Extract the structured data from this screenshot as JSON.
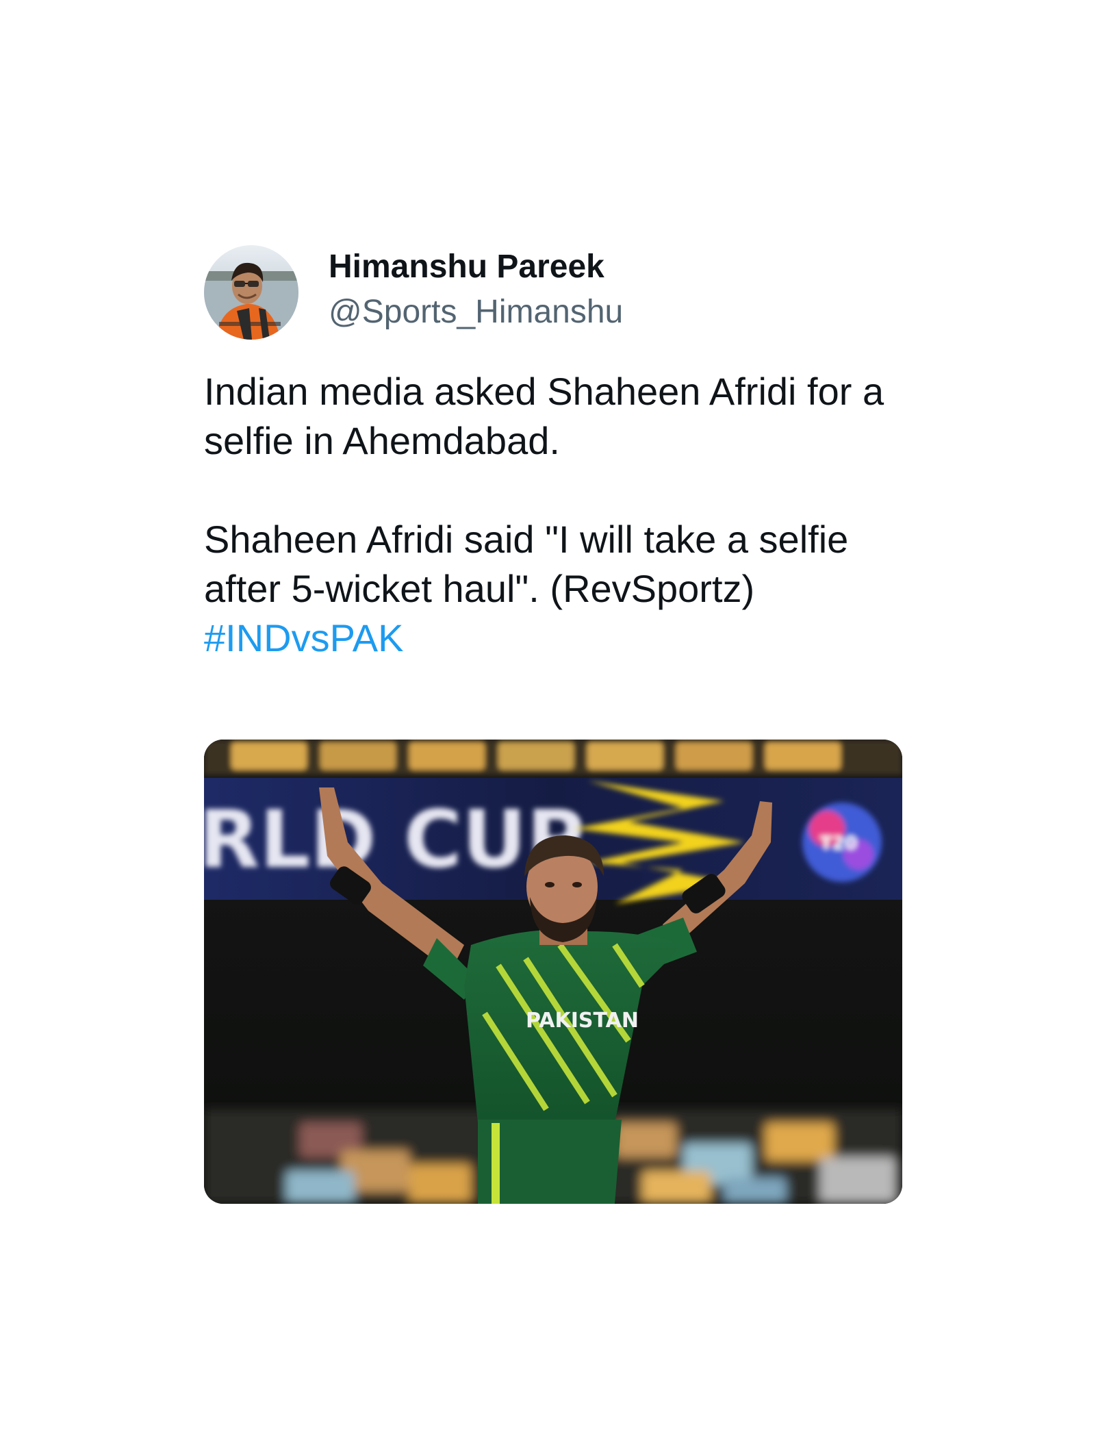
{
  "author": {
    "display_name": "Himanshu Pareek",
    "handle": "@Sports_Himanshu",
    "avatar_icon": "profile-photo"
  },
  "tweet": {
    "line1": "Indian media asked Shaheen Afridi for a selfie in Ahemdabad.",
    "line2": "Shaheen Afridi said \"I will take a selfie after 5-wicket haul\". (RevSportz)",
    "hashtag": "#INDvsPAK"
  },
  "media": {
    "banner_text": "RLD CUP",
    "jersey_text": "PAKISTAN"
  },
  "colors": {
    "text": "#0f1419",
    "secondary": "#536471",
    "link": "#1d9bf0"
  }
}
